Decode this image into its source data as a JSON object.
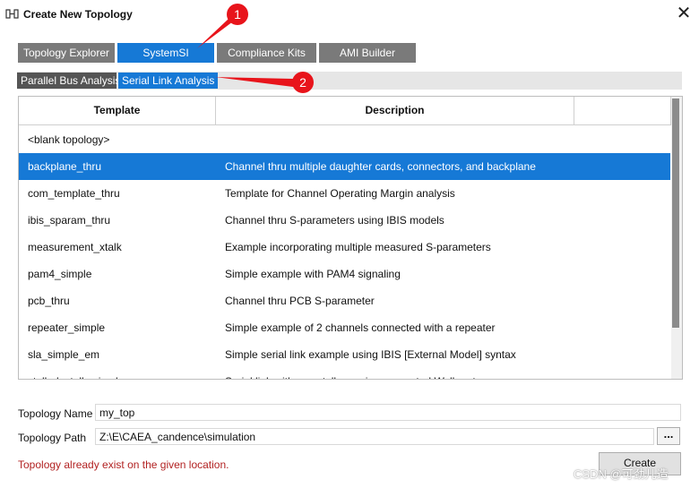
{
  "window": {
    "title": "Create New Topology",
    "close_label": "✕",
    "icon": "topology-app-icon"
  },
  "tabs": [
    {
      "label": "Topology Explorer",
      "active": false
    },
    {
      "label": "SystemSI",
      "active": true
    },
    {
      "label": "Compliance Kits",
      "active": false
    },
    {
      "label": "AMI Builder",
      "active": false
    }
  ],
  "subtabs": [
    {
      "label": "Parallel Bus Analysis",
      "active": false
    },
    {
      "label": "Serial Link Analysis",
      "active": true
    }
  ],
  "table": {
    "headers": [
      "Template",
      "Description"
    ],
    "rows": [
      {
        "template": "<blank topology>",
        "description": ""
      },
      {
        "template": "backplane_thru",
        "description": "Channel thru multiple daughter cards, connectors, and backplane",
        "selected": true
      },
      {
        "template": "com_template_thru",
        "description": "Template for Channel Operating Margin analysis"
      },
      {
        "template": "ibis_sparam_thru",
        "description": "Channel thru S-parameters using IBIS models"
      },
      {
        "template": "measurement_xtalk",
        "description": "Example incorporating multiple measured S-parameters"
      },
      {
        "template": "pam4_simple",
        "description": "Simple example with PAM4 signaling"
      },
      {
        "template": "pcb_thru",
        "description": "Channel thru PCB S-parameter"
      },
      {
        "template": "repeater_simple",
        "description": "Simple example of 2 channels connected with a repeater"
      },
      {
        "template": "sla_simple_em",
        "description": "Simple serial link example using IBIS [External Model] syntax"
      },
      {
        "template": "stalled_xtalk_simple",
        "description": "Serial link with crosstalk ... using generated Walk ... t"
      }
    ]
  },
  "form": {
    "name_label": "Topology Name",
    "name_value": "my_top",
    "path_label": "Topology Path",
    "path_value": "Z:\\E\\CAEA_candence\\simulation",
    "browse_label": "...",
    "error_text": "Topology already exist on the given location.",
    "create_label": "Create"
  },
  "annotations": {
    "marker1": "1",
    "marker2": "2",
    "color": "#e8141b"
  },
  "watermark": "CSDN @可劲儿造",
  "colors": {
    "accent": "#1679d6",
    "tab_inactive": "#7a7a7a",
    "subtab_inactive": "#555555",
    "error": "#b22222"
  }
}
